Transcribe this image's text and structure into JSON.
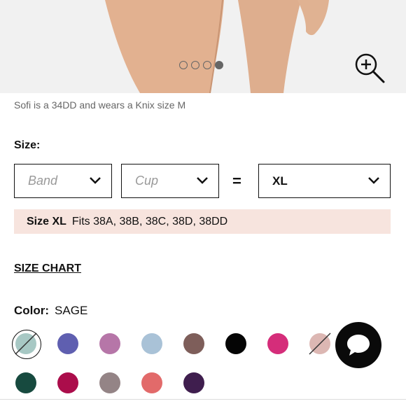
{
  "gallery": {
    "dots": [
      false,
      false,
      false,
      true
    ],
    "zoom_icon": "zoom-in-icon"
  },
  "caption": "Sofi is a 34DD and wears a Knix size M",
  "size": {
    "label": "Size:",
    "band_placeholder": "Band",
    "cup_placeholder": "Cup",
    "equals": "=",
    "selected": "XL",
    "fit_size": "Size XL",
    "fit_text": "Fits 38A, 38B, 38C, 38D, 38DD"
  },
  "size_chart": "SIZE CHART",
  "color": {
    "label": "Color:",
    "selected_name": "SAGE",
    "swatches_row1": [
      {
        "color": "#a7c8c4",
        "selected": true,
        "unavailable": true
      },
      {
        "color": "#5f5fb0"
      },
      {
        "color": "#b676a8"
      },
      {
        "color": "#a9c2d7"
      },
      {
        "color": "#7e5e5a"
      },
      {
        "color": "#050505"
      },
      {
        "color": "#d52d7a"
      },
      {
        "color": "#dcb7b3",
        "unavailable": true
      }
    ],
    "swatches_row2": [
      {
        "color": "#174a3f"
      },
      {
        "color": "#ab0d4b"
      },
      {
        "color": "#948486"
      },
      {
        "color": "#e26a6a"
      },
      {
        "color": "#3f1e4e"
      }
    ]
  },
  "chat": {
    "icon": "chat-bubble-icon"
  }
}
